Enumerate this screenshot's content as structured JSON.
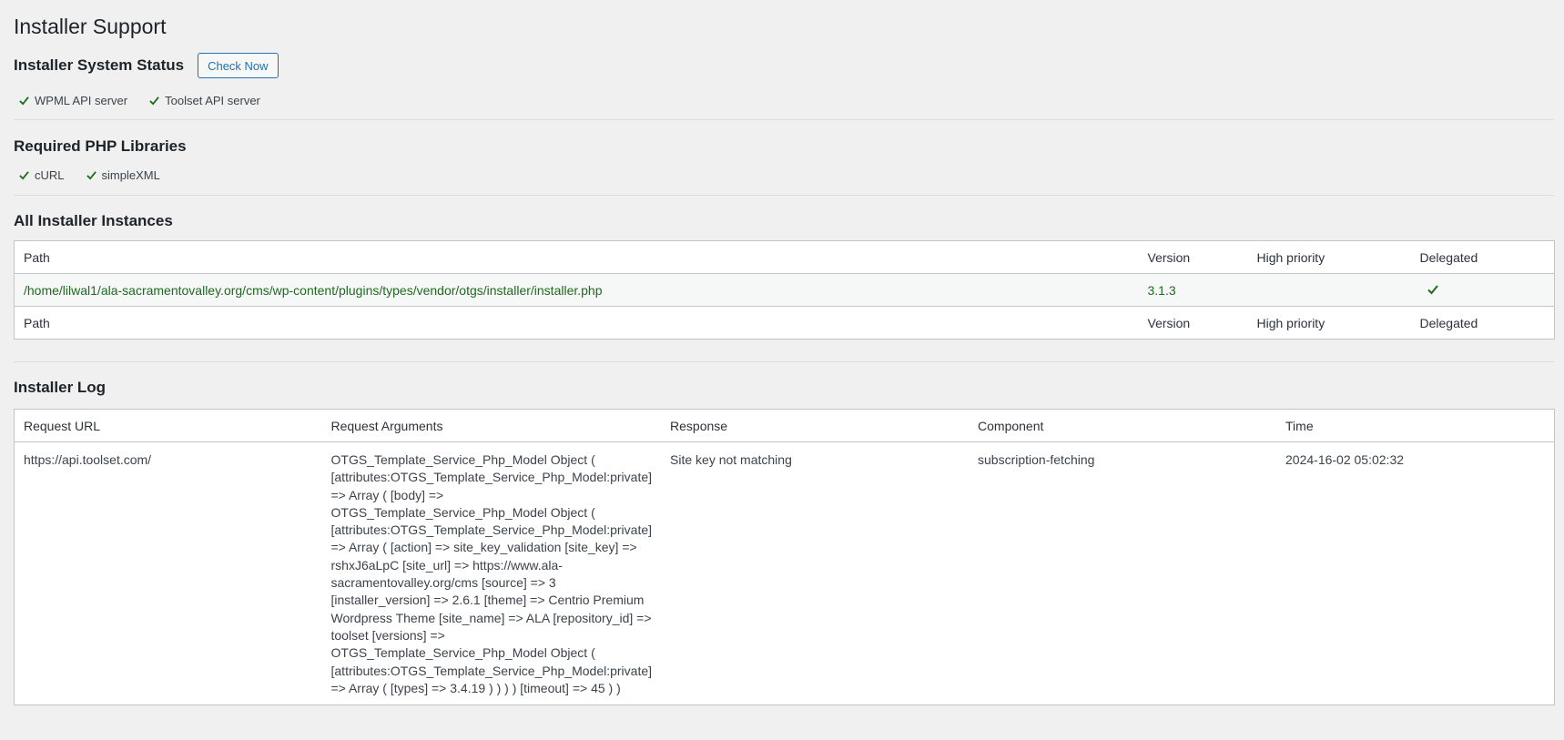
{
  "page": {
    "title": "Installer Support"
  },
  "system_status": {
    "heading": "Installer System Status",
    "check_button": "Check Now",
    "items": [
      "WPML API server",
      "Toolset API server"
    ]
  },
  "php_libraries": {
    "heading": "Required PHP Libraries",
    "items": [
      "cURL",
      "simpleXML"
    ]
  },
  "instances": {
    "heading": "All Installer Instances",
    "columns": [
      "Path",
      "Version",
      "High priority",
      "Delegated"
    ],
    "rows": [
      {
        "path": "/home/lilwal1/ala-sacramentovalley.org/cms/wp-content/plugins/types/vendor/otgs/installer/installer.php",
        "version": "3.1.3",
        "high_priority": "",
        "delegated": true
      }
    ]
  },
  "log": {
    "heading": "Installer Log",
    "columns": [
      "Request URL",
      "Request Arguments",
      "Response",
      "Component",
      "Time"
    ],
    "rows": [
      {
        "url": "https://api.toolset.com/",
        "args": "OTGS_Template_Service_Php_Model Object ( [attributes:OTGS_Template_Service_Php_Model:private] => Array ( [body] => OTGS_Template_Service_Php_Model Object ( [attributes:OTGS_Template_Service_Php_Model:private] => Array ( [action] => site_key_validation [site_key] => rshxJ6aLpC [site_url] => https://www.ala-sacramentovalley.org/cms [source] => 3 [installer_version] => 2.6.1 [theme] => Centrio Premium Wordpress Theme [site_name] => ALA [repository_id] => toolset [versions] => OTGS_Template_Service_Php_Model Object ( [attributes:OTGS_Template_Service_Php_Model:private] => Array ( [types] => 3.4.19 ) ) ) ) [timeout] => 45 ) )",
        "response": "Site key not matching",
        "component": "subscription-fetching",
        "time": "2024-16-02 05:02:32"
      }
    ]
  },
  "colors": {
    "accent": "#2271b1",
    "success": "#1e6b1e",
    "check": "#1e6b1e"
  }
}
